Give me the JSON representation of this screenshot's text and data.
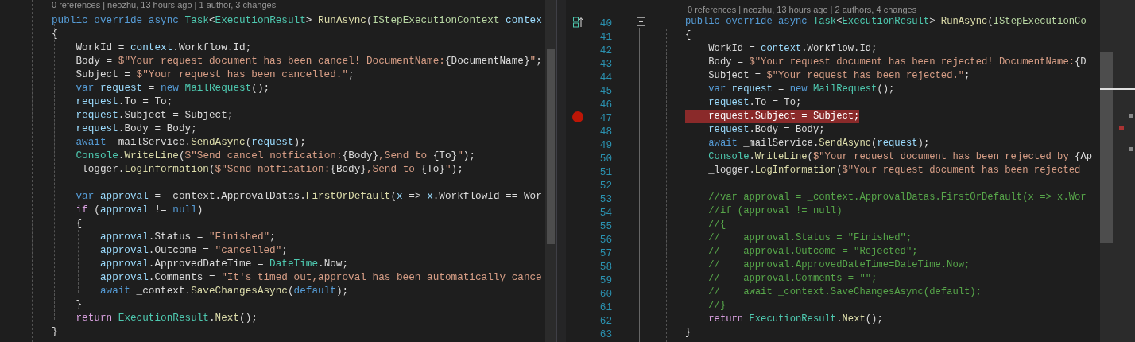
{
  "left_pane": {
    "code_lens": "0 references | neozhu, 13 hours ago | 1 author, 3 changes",
    "lines": [
      {
        "kind": "code",
        "tokens": [
          {
            "kind": "k",
            "text": "public override async "
          },
          {
            "kind": "t",
            "text": "Task"
          },
          {
            "kind": "p",
            "text": "<"
          },
          {
            "kind": "t",
            "text": "ExecutionResult"
          },
          {
            "kind": "p",
            "text": "> "
          },
          {
            "kind": "m",
            "text": "RunAsync"
          },
          {
            "kind": "p",
            "text": "("
          },
          {
            "kind": "i",
            "text": "IStepExecutionContext"
          },
          {
            "kind": "v",
            "text": " contex"
          }
        ]
      },
      {
        "kind": "code",
        "tokens": [
          {
            "kind": "p",
            "text": "{"
          }
        ]
      },
      {
        "kind": "code",
        "tokens": [
          {
            "kind": "p",
            "text": "    WorkId = "
          },
          {
            "kind": "v",
            "text": "context"
          },
          {
            "kind": "p",
            "text": ".Workflow.Id;"
          }
        ]
      },
      {
        "kind": "code",
        "tokens": [
          {
            "kind": "p",
            "text": "    Body = "
          },
          {
            "kind": "s",
            "text": "$\"Your request document has been cancel! DocumentName:"
          },
          {
            "kind": "p",
            "text": "{DocumentName}"
          },
          {
            "kind": "s",
            "text": "\""
          },
          {
            "kind": "p",
            "text": ";"
          }
        ]
      },
      {
        "kind": "code",
        "tokens": [
          {
            "kind": "p",
            "text": "    Subject = "
          },
          {
            "kind": "s",
            "text": "$\"Your request has been cancelled.\""
          },
          {
            "kind": "p",
            "text": ";"
          }
        ]
      },
      {
        "kind": "code",
        "tokens": [
          {
            "kind": "k",
            "text": "    var "
          },
          {
            "kind": "v",
            "text": "request"
          },
          {
            "kind": "p",
            "text": " = "
          },
          {
            "kind": "k",
            "text": "new "
          },
          {
            "kind": "t",
            "text": "MailRequest"
          },
          {
            "kind": "p",
            "text": "();"
          }
        ]
      },
      {
        "kind": "code",
        "tokens": [
          {
            "kind": "v",
            "text": "    request"
          },
          {
            "kind": "p",
            "text": ".To = To;"
          }
        ]
      },
      {
        "kind": "code",
        "tokens": [
          {
            "kind": "v",
            "text": "    request"
          },
          {
            "kind": "p",
            "text": ".Subject = Subject;"
          }
        ]
      },
      {
        "kind": "code",
        "tokens": [
          {
            "kind": "v",
            "text": "    request"
          },
          {
            "kind": "p",
            "text": ".Body = Body;"
          }
        ]
      },
      {
        "kind": "code",
        "tokens": [
          {
            "kind": "k",
            "text": "    await "
          },
          {
            "kind": "p",
            "text": "_mailService."
          },
          {
            "kind": "m",
            "text": "SendAsync"
          },
          {
            "kind": "p",
            "text": "("
          },
          {
            "kind": "v",
            "text": "request"
          },
          {
            "kind": "p",
            "text": ");"
          }
        ]
      },
      {
        "kind": "code",
        "tokens": [
          {
            "kind": "t",
            "text": "    Console"
          },
          {
            "kind": "p",
            "text": "."
          },
          {
            "kind": "m",
            "text": "WriteLine"
          },
          {
            "kind": "p",
            "text": "("
          },
          {
            "kind": "s",
            "text": "$\"Send cancel notfication:"
          },
          {
            "kind": "p",
            "text": "{Body}"
          },
          {
            "kind": "s",
            "text": ",Send to "
          },
          {
            "kind": "p",
            "text": "{To}"
          },
          {
            "kind": "s",
            "text": "\""
          },
          {
            "kind": "p",
            "text": ");"
          }
        ]
      },
      {
        "kind": "code",
        "tokens": [
          {
            "kind": "p",
            "text": "    _logger."
          },
          {
            "kind": "m",
            "text": "LogInformation"
          },
          {
            "kind": "p",
            "text": "("
          },
          {
            "kind": "s",
            "text": "$\"Send notfication:"
          },
          {
            "kind": "p",
            "text": "{Body}"
          },
          {
            "kind": "s",
            "text": ",Send to "
          },
          {
            "kind": "p",
            "text": "{To}"
          },
          {
            "kind": "s",
            "text": "\""
          },
          {
            "kind": "p",
            "text": ");"
          }
        ]
      },
      {
        "kind": "blank"
      },
      {
        "kind": "code",
        "tokens": [
          {
            "kind": "k",
            "text": "    var "
          },
          {
            "kind": "v",
            "text": "approval"
          },
          {
            "kind": "p",
            "text": " = _context.ApprovalDatas."
          },
          {
            "kind": "m",
            "text": "FirstOrDefault"
          },
          {
            "kind": "p",
            "text": "("
          },
          {
            "kind": "v",
            "text": "x"
          },
          {
            "kind": "p",
            "text": " => "
          },
          {
            "kind": "v",
            "text": "x"
          },
          {
            "kind": "p",
            "text": ".WorkflowId == Wor"
          }
        ]
      },
      {
        "kind": "code",
        "tokens": [
          {
            "kind": "c",
            "text": "    if "
          },
          {
            "kind": "p",
            "text": "("
          },
          {
            "kind": "v",
            "text": "approval"
          },
          {
            "kind": "p",
            "text": " != "
          },
          {
            "kind": "k",
            "text": "null"
          },
          {
            "kind": "p",
            "text": ")"
          }
        ]
      },
      {
        "kind": "code",
        "tokens": [
          {
            "kind": "p",
            "text": "    {"
          }
        ]
      },
      {
        "kind": "code",
        "tokens": [
          {
            "kind": "v",
            "text": "        approval"
          },
          {
            "kind": "p",
            "text": ".Status = "
          },
          {
            "kind": "s",
            "text": "\"Finished\""
          },
          {
            "kind": "p",
            "text": ";"
          }
        ]
      },
      {
        "kind": "code",
        "tokens": [
          {
            "kind": "v",
            "text": "        approval"
          },
          {
            "kind": "p",
            "text": ".Outcome = "
          },
          {
            "kind": "s",
            "text": "\"cancelled\""
          },
          {
            "kind": "p",
            "text": ";"
          }
        ]
      },
      {
        "kind": "code",
        "tokens": [
          {
            "kind": "v",
            "text": "        approval"
          },
          {
            "kind": "p",
            "text": ".ApprovedDateTime = "
          },
          {
            "kind": "t",
            "text": "DateTime"
          },
          {
            "kind": "p",
            "text": ".Now;"
          }
        ]
      },
      {
        "kind": "code",
        "tokens": [
          {
            "kind": "v",
            "text": "        approval"
          },
          {
            "kind": "p",
            "text": ".Comments = "
          },
          {
            "kind": "s",
            "text": "\"It's timed out,approval has been automatically cance"
          }
        ]
      },
      {
        "kind": "code",
        "tokens": [
          {
            "kind": "k",
            "text": "        await "
          },
          {
            "kind": "p",
            "text": "_context."
          },
          {
            "kind": "m",
            "text": "SaveChangesAsync"
          },
          {
            "kind": "p",
            "text": "("
          },
          {
            "kind": "k",
            "text": "default"
          },
          {
            "kind": "p",
            "text": ");"
          }
        ]
      },
      {
        "kind": "code",
        "tokens": [
          {
            "kind": "p",
            "text": "    }"
          }
        ]
      },
      {
        "kind": "code",
        "tokens": [
          {
            "kind": "c",
            "text": "    return "
          },
          {
            "kind": "t",
            "text": "ExecutionResult"
          },
          {
            "kind": "p",
            "text": "."
          },
          {
            "kind": "m",
            "text": "Next"
          },
          {
            "kind": "p",
            "text": "();"
          }
        ]
      },
      {
        "kind": "code",
        "tokens": [
          {
            "kind": "p",
            "text": "}"
          }
        ]
      }
    ]
  },
  "right_pane": {
    "code_lens": "0 references | neozhu, 13 hours ago | 2 authors, 4 changes",
    "method_fold": {
      "expanded": true
    },
    "lines": [
      {
        "number": "40",
        "breakpoint": false,
        "tokens": [
          {
            "kind": "k",
            "text": "public override async "
          },
          {
            "kind": "t",
            "text": "Task"
          },
          {
            "kind": "p",
            "text": "<"
          },
          {
            "kind": "t",
            "text": "ExecutionResult"
          },
          {
            "kind": "p",
            "text": "> "
          },
          {
            "kind": "m",
            "text": "RunAsync"
          },
          {
            "kind": "p",
            "text": "("
          },
          {
            "kind": "i",
            "text": "IStepExecutionCo"
          }
        ]
      },
      {
        "number": "41",
        "breakpoint": false,
        "tokens": [
          {
            "kind": "p",
            "text": "{"
          }
        ]
      },
      {
        "number": "42",
        "breakpoint": false,
        "tokens": [
          {
            "kind": "p",
            "text": "    WorkId = "
          },
          {
            "kind": "v",
            "text": "context"
          },
          {
            "kind": "p",
            "text": ".Workflow.Id;"
          }
        ]
      },
      {
        "number": "43",
        "breakpoint": false,
        "tokens": [
          {
            "kind": "p",
            "text": "    Body = "
          },
          {
            "kind": "s",
            "text": "$\"Your request document has been rejected! DocumentName:"
          },
          {
            "kind": "p",
            "text": "{D"
          }
        ]
      },
      {
        "number": "44",
        "breakpoint": false,
        "tokens": [
          {
            "kind": "p",
            "text": "    Subject = "
          },
          {
            "kind": "s",
            "text": "$\"Your request has been rejected.\""
          },
          {
            "kind": "p",
            "text": ";"
          }
        ]
      },
      {
        "number": "45",
        "breakpoint": false,
        "tokens": [
          {
            "kind": "k",
            "text": "    var "
          },
          {
            "kind": "v",
            "text": "request"
          },
          {
            "kind": "p",
            "text": " = "
          },
          {
            "kind": "k",
            "text": "new "
          },
          {
            "kind": "t",
            "text": "MailRequest"
          },
          {
            "kind": "p",
            "text": "();"
          }
        ]
      },
      {
        "number": "46",
        "breakpoint": false,
        "tokens": [
          {
            "kind": "v",
            "text": "    request"
          },
          {
            "kind": "p",
            "text": ".To = To;"
          }
        ]
      },
      {
        "number": "47",
        "breakpoint": true,
        "tokens": [
          {
            "kind": "v",
            "text": "    request"
          },
          {
            "kind": "p",
            "text": ".Subject = Subject;"
          }
        ]
      },
      {
        "number": "48",
        "breakpoint": false,
        "tokens": [
          {
            "kind": "v",
            "text": "    request"
          },
          {
            "kind": "p",
            "text": ".Body = Body;"
          }
        ]
      },
      {
        "number": "49",
        "breakpoint": false,
        "tokens": [
          {
            "kind": "k",
            "text": "    await "
          },
          {
            "kind": "p",
            "text": "_mailService."
          },
          {
            "kind": "m",
            "text": "SendAsync"
          },
          {
            "kind": "p",
            "text": "("
          },
          {
            "kind": "v",
            "text": "request"
          },
          {
            "kind": "p",
            "text": ");"
          }
        ]
      },
      {
        "number": "50",
        "breakpoint": false,
        "tokens": [
          {
            "kind": "t",
            "text": "    Console"
          },
          {
            "kind": "p",
            "text": "."
          },
          {
            "kind": "m",
            "text": "WriteLine"
          },
          {
            "kind": "p",
            "text": "("
          },
          {
            "kind": "s",
            "text": "$\"Your request document has been rejected by "
          },
          {
            "kind": "p",
            "text": "{Ap"
          }
        ]
      },
      {
        "number": "51",
        "breakpoint": false,
        "tokens": [
          {
            "kind": "p",
            "text": "    _logger."
          },
          {
            "kind": "m",
            "text": "LogInformation"
          },
          {
            "kind": "p",
            "text": "("
          },
          {
            "kind": "s",
            "text": "$\"Your request document has been rejected"
          }
        ]
      },
      {
        "number": "52",
        "breakpoint": false
      },
      {
        "number": "53",
        "breakpoint": false,
        "tokens": [
          {
            "kind": "g",
            "text": "    //var approval = _context.ApprovalDatas.FirstOrDefault(x => x.Wor"
          }
        ]
      },
      {
        "number": "54",
        "breakpoint": false,
        "tokens": [
          {
            "kind": "g",
            "text": "    //if (approval != null)"
          }
        ]
      },
      {
        "number": "55",
        "breakpoint": false,
        "tokens": [
          {
            "kind": "g",
            "text": "    //{"
          }
        ]
      },
      {
        "number": "56",
        "breakpoint": false,
        "tokens": [
          {
            "kind": "g",
            "text": "    //    approval.Status = \"Finished\";"
          }
        ]
      },
      {
        "number": "57",
        "breakpoint": false,
        "tokens": [
          {
            "kind": "g",
            "text": "    //    approval.Outcome = \"Rejected\";"
          }
        ]
      },
      {
        "number": "58",
        "breakpoint": false,
        "tokens": [
          {
            "kind": "g",
            "text": "    //    approval.ApprovedDateTime=DateTime.Now;"
          }
        ]
      },
      {
        "number": "59",
        "breakpoint": false,
        "tokens": [
          {
            "kind": "g",
            "text": "    //    approval.Comments = \"\";"
          }
        ]
      },
      {
        "number": "60",
        "breakpoint": false,
        "tokens": [
          {
            "kind": "g",
            "text": "    //    await _context.SaveChangesAsync(default);"
          }
        ]
      },
      {
        "number": "61",
        "breakpoint": false,
        "tokens": [
          {
            "kind": "g",
            "text": "    //}"
          }
        ]
      },
      {
        "number": "62",
        "breakpoint": false,
        "tokens": [
          {
            "kind": "c",
            "text": "    return "
          },
          {
            "kind": "t",
            "text": "ExecutionResult"
          },
          {
            "kind": "p",
            "text": "."
          },
          {
            "kind": "m",
            "text": "Next"
          },
          {
            "kind": "p",
            "text": "();"
          }
        ]
      },
      {
        "number": "63",
        "breakpoint": false,
        "tokens": [
          {
            "kind": "p",
            "text": "}"
          }
        ]
      }
    ]
  }
}
